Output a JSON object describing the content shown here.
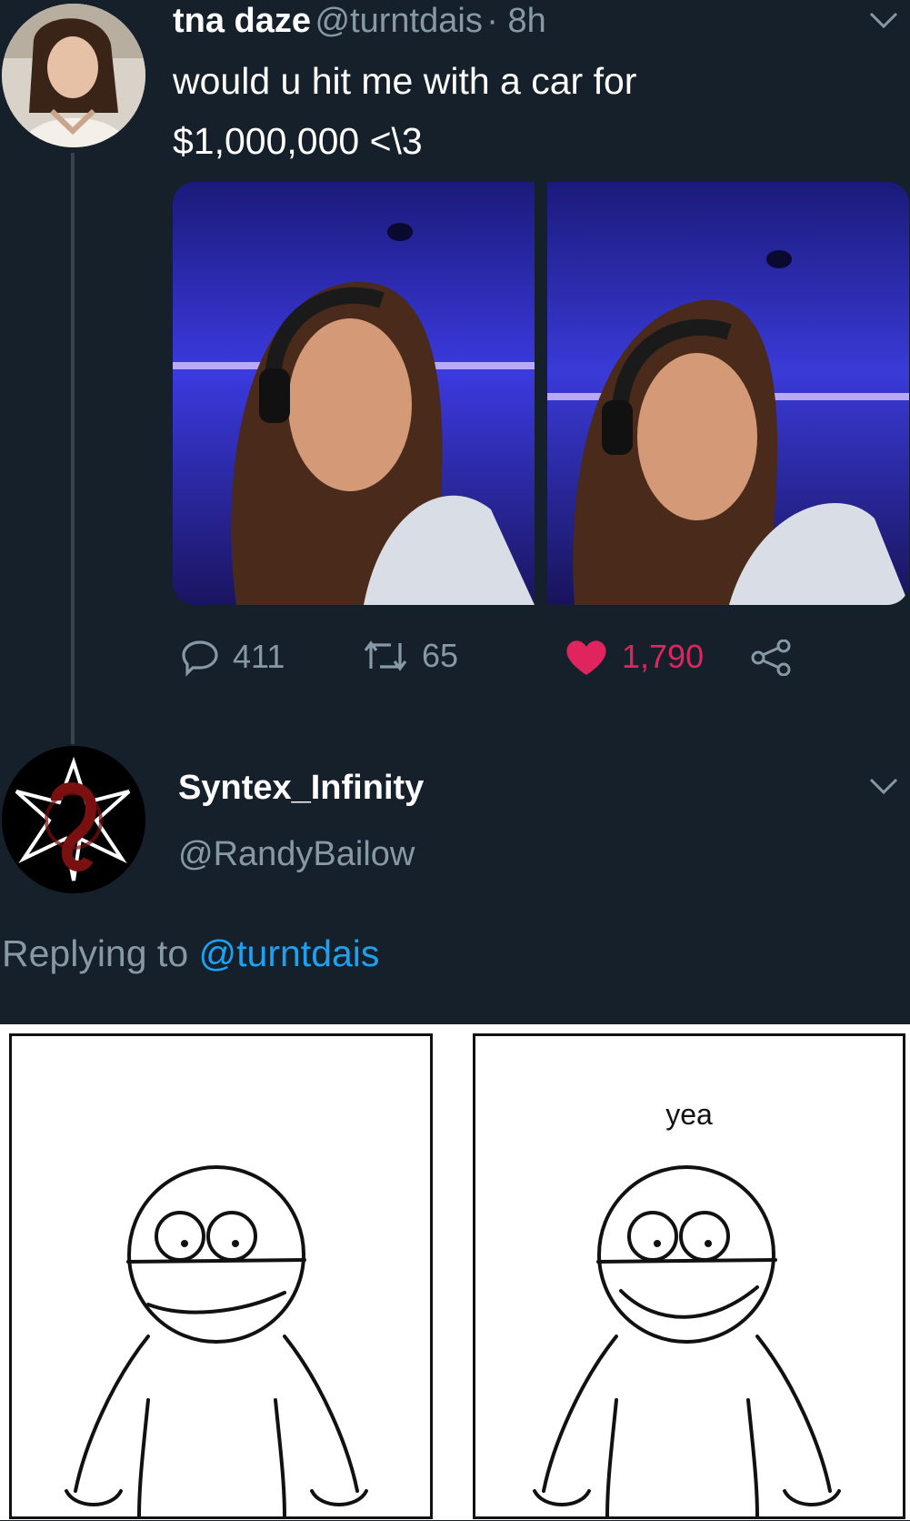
{
  "tweet": {
    "name": "tna daze",
    "handle": "@turntdais",
    "sep_time": "· 8h",
    "text_line1": "would u hit me with a car for",
    "text_line2": "$1,000,000 <\\3",
    "actions": {
      "replies": "411",
      "retweets": "65",
      "likes": "1,790"
    }
  },
  "reply": {
    "name": "Syntex_Infinity",
    "handle": "@RandyBailow",
    "replying_prefix": "Replying to",
    "replying_handle": "@turntdais",
    "comic": {
      "right_caption": "yea"
    }
  },
  "colors": {
    "background": "#15202b",
    "secondary_text": "#8899a6",
    "link": "#1da1f2",
    "like": "#e0245e"
  },
  "icons": [
    "reply-icon",
    "retweet-icon",
    "heart-icon",
    "share-icon",
    "chevron-down-icon"
  ]
}
